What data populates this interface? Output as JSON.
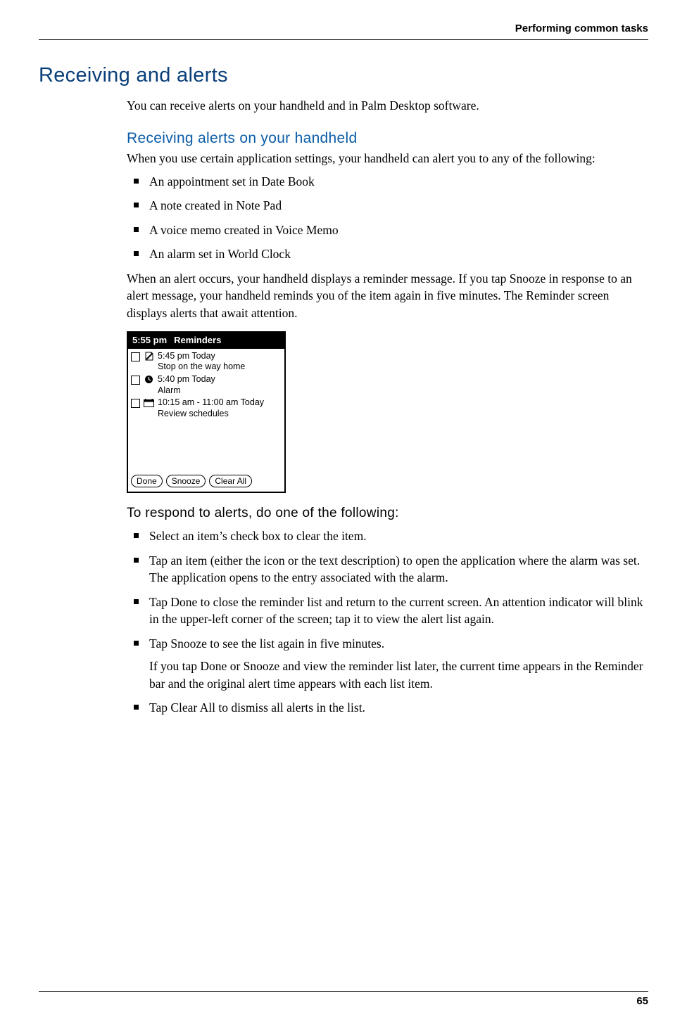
{
  "running_header": "Performing common tasks",
  "page_number": "65",
  "h1": "Receiving and alerts",
  "intro": "You can receive alerts on your handheld and in Palm Desktop software.",
  "h2": "Receiving alerts on your handheld",
  "para1": "When you use certain application settings, your handheld can alert you to any of the following:",
  "bullets1": {
    "b0": "An appointment set in Date Book",
    "b1": "A note created in Note Pad",
    "b2": "A voice memo created in Voice Memo",
    "b3": "An alarm set in World Clock"
  },
  "para2": "When an alert occurs, your handheld displays a reminder message. If you tap Snooze in response to an alert message, your handheld reminds you of the item again in five minutes. The Reminder screen displays alerts that await attention.",
  "device": {
    "time": "5:55 pm",
    "title": "Reminders",
    "items": [
      {
        "line1": "5:45 pm Today",
        "line2": "Stop on the way home"
      },
      {
        "line1": "5:40 pm Today",
        "line2": "Alarm"
      },
      {
        "line1": "10:15 am - 11:00 am Today",
        "line2": "Review schedules"
      }
    ],
    "buttons": {
      "done": "Done",
      "snooze": "Snooze",
      "clear": "Clear All"
    }
  },
  "h3": "To respond to alerts, do one of the following:",
  "bullets2": {
    "b0": "Select an item’s check box to clear the item.",
    "b1": "Tap an item (either the icon or the text description) to open the application where the alarm was set. The application opens to the entry associated with the alarm.",
    "b2": "Tap Done to close the reminder list and return to the current screen. An attention indicator will blink in the upper-left corner of the screen; tap it to view the alert list again.",
    "b3": "Tap Snooze to see the list again in five minutes.",
    "b3_follow": "If you tap Done or Snooze and view the reminder list later, the current time appears in the Reminder bar and the original alert time appears with each list item.",
    "b4": "Tap Clear All to dismiss all alerts in the list."
  }
}
